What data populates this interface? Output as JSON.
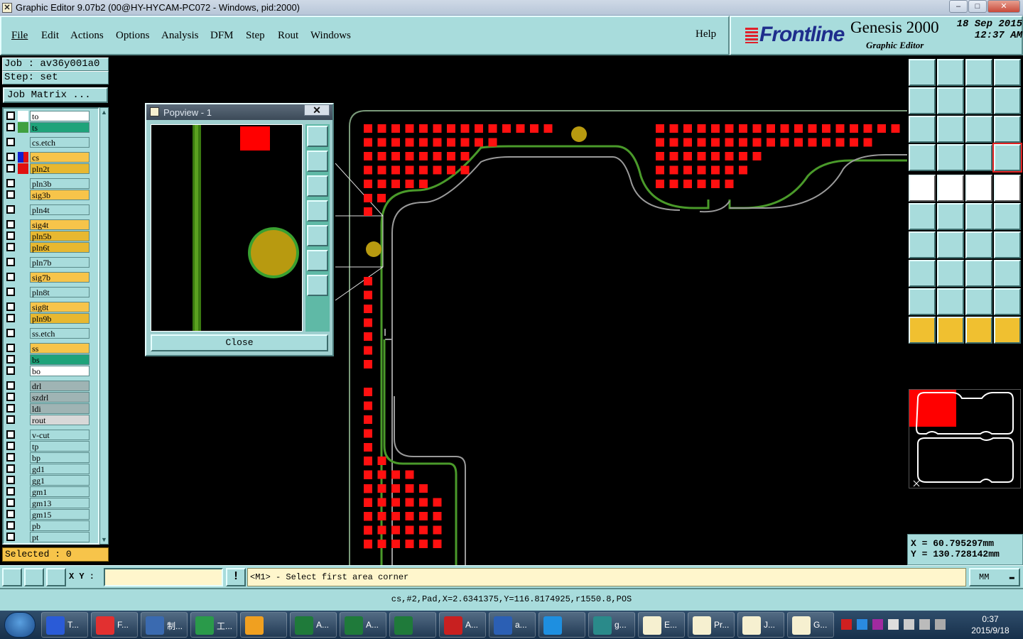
{
  "window": {
    "title": "Graphic Editor 9.07b2 (00@HY-HYCAM-PC072 - Windows, pid:2000)",
    "min": "–",
    "max": "□",
    "close": "✕"
  },
  "menu": {
    "items": [
      "File",
      "Edit",
      "Actions",
      "Options",
      "Analysis",
      "DFM",
      "Step",
      "Rout",
      "Windows"
    ],
    "help": "Help"
  },
  "brand": {
    "logo": "Frontline",
    "product": "Genesis 2000",
    "subtitle": "Graphic Editor",
    "date": "18 Sep 2015",
    "time": "12:37 AM"
  },
  "job": {
    "job_label": "Job : av36y001a0",
    "step_label": "Step: set",
    "matrix_button": "Job Matrix ..."
  },
  "layers": [
    {
      "name": "to",
      "color": "#ffffff",
      "c2": "#ffffff"
    },
    {
      "name": "ts",
      "color": "#1fa37a",
      "c2": "#3fa040"
    },
    {
      "name": "cs.etch",
      "color": "#a8dcdc",
      "c2": ""
    },
    {
      "name": "cs",
      "color": "#f7c44a",
      "c2": "#e01010",
      "active": true
    },
    {
      "name": "pln2t",
      "color": "#e8b830",
      "c2": "#e01010"
    },
    {
      "name": "pln3b",
      "color": "#a8dcdc",
      "c2": ""
    },
    {
      "name": "sig3b",
      "color": "#f7c44a",
      "c2": ""
    },
    {
      "name": "pln4t",
      "color": "#a8dcdc",
      "c2": ""
    },
    {
      "name": "sig4t",
      "color": "#f7c44a",
      "c2": ""
    },
    {
      "name": "pln5b",
      "color": "#e8b830",
      "c2": ""
    },
    {
      "name": "pln6t",
      "color": "#e8b830",
      "c2": ""
    },
    {
      "name": "pln7b",
      "color": "#a8dcdc",
      "c2": ""
    },
    {
      "name": "sig7b",
      "color": "#f7c44a",
      "c2": ""
    },
    {
      "name": "pln8t",
      "color": "#a8dcdc",
      "c2": ""
    },
    {
      "name": "sig8t",
      "color": "#f7c44a",
      "c2": ""
    },
    {
      "name": "pln9b",
      "color": "#e8b830",
      "c2": ""
    },
    {
      "name": "ss.etch",
      "color": "#a8dcdc",
      "c2": ""
    },
    {
      "name": "ss",
      "color": "#f7c44a",
      "c2": ""
    },
    {
      "name": "bs",
      "color": "#1fa37a",
      "c2": ""
    },
    {
      "name": "bo",
      "color": "#ffffff",
      "c2": ""
    },
    {
      "name": "drl",
      "color": "#9fb4b4",
      "c2": ""
    },
    {
      "name": "szdrl",
      "color": "#9fb4b4",
      "c2": ""
    },
    {
      "name": "ldi",
      "color": "#9fb4b4",
      "c2": ""
    },
    {
      "name": "rout",
      "color": "#d8d8d8",
      "c2": ""
    },
    {
      "name": "v-cut",
      "color": "#a8dcdc",
      "c2": ""
    },
    {
      "name": "tp",
      "color": "#a8dcdc",
      "c2": ""
    },
    {
      "name": "bp",
      "color": "#a8dcdc",
      "c2": ""
    },
    {
      "name": "gd1",
      "color": "#a8dcdc",
      "c2": ""
    },
    {
      "name": "gg1",
      "color": "#a8dcdc",
      "c2": ""
    },
    {
      "name": "gm1",
      "color": "#a8dcdc",
      "c2": ""
    },
    {
      "name": "gm13",
      "color": "#a8dcdc",
      "c2": ""
    },
    {
      "name": "gm15",
      "color": "#a8dcdc",
      "c2": ""
    },
    {
      "name": "pb",
      "color": "#a8dcdc",
      "c2": ""
    },
    {
      "name": "pt",
      "color": "#a8dcdc",
      "c2": ""
    }
  ],
  "selected": "Selected : 0",
  "popview": {
    "title": "Popview - 1",
    "close_x": "✕",
    "close_button": "Close"
  },
  "coords": {
    "x": "X = 60.795297mm",
    "y": "Y = 130.728142mm"
  },
  "command": {
    "xy_label": "X Y :",
    "prompt": "<M1> - Select first area corner",
    "units": "MM"
  },
  "status": "cs,#2,Pad,X=2.6341375,Y=116.8174925,r1550.8,POS",
  "taskbar": {
    "items": [
      {
        "label": "T...",
        "color": "#2a5bd7"
      },
      {
        "label": "F...",
        "color": "#e23030"
      },
      {
        "label": "制...",
        "color": "#3a6ab0"
      },
      {
        "label": "工...",
        "color": "#2a9a4a"
      },
      {
        "label": "",
        "color": "#f0a020"
      },
      {
        "label": "A...",
        "color": "#1f7a3a"
      },
      {
        "label": "A...",
        "color": "#1f7a3a"
      },
      {
        "label": "",
        "color": "#1f7a3a"
      },
      {
        "label": "A...",
        "color": "#c82020"
      },
      {
        "label": "a...",
        "color": "#2b5fb4"
      },
      {
        "label": "",
        "color": "#1e8fe0"
      },
      {
        "label": "g...",
        "color": "#2a8a8a"
      },
      {
        "label": "E...",
        "color": "#f6f0d0"
      },
      {
        "label": "Pr...",
        "color": "#f6f0d0"
      },
      {
        "label": "J...",
        "color": "#f6f0d0"
      },
      {
        "label": "G...",
        "color": "#f6f0d0"
      }
    ],
    "time": "0:37",
    "date": "2015/9/18"
  }
}
